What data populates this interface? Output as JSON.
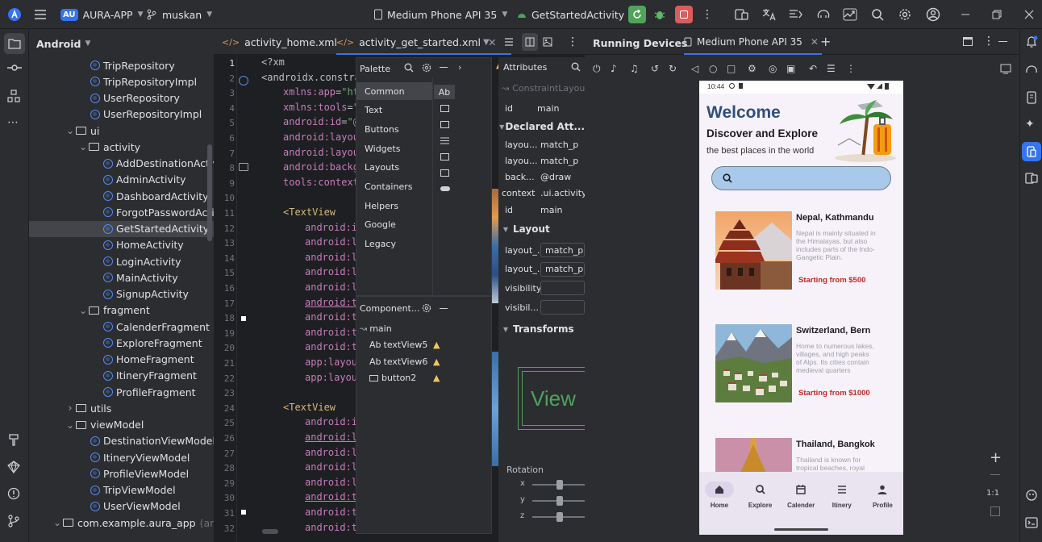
{
  "titlebar": {
    "project_badge": "AU",
    "project_name": "AURA-APP",
    "branch": "muskan",
    "device": "Medium Phone API 35",
    "run_config": "GetStartedActivity"
  },
  "project": {
    "view_mode": "Android",
    "items": [
      {
        "label": "TripRepository",
        "level": 3,
        "kind": "class"
      },
      {
        "label": "TripRepositoryImpl",
        "level": 3,
        "kind": "class"
      },
      {
        "label": "UserRepository",
        "level": 3,
        "kind": "class"
      },
      {
        "label": "UserRepositoryImpl",
        "level": 3,
        "kind": "class"
      },
      {
        "label": "ui",
        "level": 2,
        "kind": "folder",
        "open": true
      },
      {
        "label": "activity",
        "level": 3,
        "kind": "folder",
        "open": true
      },
      {
        "label": "AddDestinationActiv",
        "level": 4,
        "kind": "class"
      },
      {
        "label": "AdminActivity",
        "level": 4,
        "kind": "class"
      },
      {
        "label": "DashboardActivity",
        "level": 4,
        "kind": "class"
      },
      {
        "label": "ForgotPasswordActi",
        "level": 4,
        "kind": "class"
      },
      {
        "label": "GetStartedActivity",
        "level": 4,
        "kind": "class",
        "selected": true
      },
      {
        "label": "HomeActivity",
        "level": 4,
        "kind": "class"
      },
      {
        "label": "LoginActivity",
        "level": 4,
        "kind": "class"
      },
      {
        "label": "MainActivity",
        "level": 4,
        "kind": "class"
      },
      {
        "label": "SignupActivity",
        "level": 4,
        "kind": "class"
      },
      {
        "label": "fragment",
        "level": 3,
        "kind": "folder",
        "open": true
      },
      {
        "label": "CalenderFragment",
        "level": 4,
        "kind": "class"
      },
      {
        "label": "ExploreFragment",
        "level": 4,
        "kind": "class"
      },
      {
        "label": "HomeFragment",
        "level": 4,
        "kind": "class"
      },
      {
        "label": "ItineryFragment",
        "level": 4,
        "kind": "class"
      },
      {
        "label": "ProfileFragment",
        "level": 4,
        "kind": "class"
      },
      {
        "label": "utils",
        "level": 2,
        "kind": "folder",
        "open": false
      },
      {
        "label": "viewModel",
        "level": 2,
        "kind": "folder",
        "open": true
      },
      {
        "label": "DestinationViewModel",
        "level": 3,
        "kind": "class"
      },
      {
        "label": "ItineryViewModel",
        "level": 3,
        "kind": "class"
      },
      {
        "label": "ProfileViewModel",
        "level": 3,
        "kind": "class"
      },
      {
        "label": "TripViewModel",
        "level": 3,
        "kind": "class"
      },
      {
        "label": "UserViewModel",
        "level": 3,
        "kind": "class"
      },
      {
        "label": "com.example.aura_app",
        "level": 1,
        "kind": "folder",
        "open": true,
        "suffix": "(andro"
      }
    ]
  },
  "editor": {
    "tabs": [
      {
        "label": "activity_home.xml",
        "active": false
      },
      {
        "label": "activity_get_started.xml",
        "active": true
      }
    ],
    "line_numbers": [
      "1",
      "2",
      "3",
      "4",
      "5",
      "6",
      "7",
      "8",
      "9",
      "10",
      "11",
      "12",
      "13",
      "14",
      "15",
      "16",
      "17",
      "18",
      "19",
      "20",
      "21",
      "22",
      "23",
      "24",
      "25",
      "26",
      "27",
      "28",
      "29",
      "30",
      "31",
      "32"
    ],
    "lines": [
      {
        "indent": 0,
        "parts": [
          [
            "k",
            "<?xm"
          ]
        ]
      },
      {
        "indent": 0,
        "parts": [
          [
            "k",
            "<androidx.constra"
          ]
        ]
      },
      {
        "indent": 2,
        "parts": [
          [
            "a",
            "xmlns:app"
          ],
          [
            "k",
            "="
          ],
          [
            "s",
            "\"ht"
          ]
        ]
      },
      {
        "indent": 2,
        "parts": [
          [
            "a",
            "xmlns:tools"
          ],
          [
            "k",
            "="
          ],
          [
            "s",
            "\""
          ]
        ]
      },
      {
        "indent": 2,
        "parts": [
          [
            "a",
            "android:id"
          ],
          [
            "k",
            "="
          ],
          [
            "s",
            "\"@"
          ]
        ]
      },
      {
        "indent": 2,
        "parts": [
          [
            "a",
            "android:layou"
          ]
        ]
      },
      {
        "indent": 2,
        "parts": [
          [
            "a",
            "android:layou"
          ]
        ]
      },
      {
        "indent": 2,
        "parts": [
          [
            "a",
            "android:backg"
          ]
        ]
      },
      {
        "indent": 2,
        "parts": [
          [
            "a",
            "tools:context"
          ]
        ]
      },
      {
        "indent": 0,
        "parts": []
      },
      {
        "indent": 2,
        "parts": [
          [
            "t",
            "<TextView"
          ]
        ]
      },
      {
        "indent": 4,
        "parts": [
          [
            "a",
            "android:i"
          ]
        ]
      },
      {
        "indent": 4,
        "parts": [
          [
            "a",
            "android:l"
          ]
        ]
      },
      {
        "indent": 4,
        "parts": [
          [
            "a",
            "android:l"
          ]
        ]
      },
      {
        "indent": 4,
        "parts": [
          [
            "a",
            "android:l"
          ]
        ]
      },
      {
        "indent": 4,
        "parts": [
          [
            "a",
            "android:l"
          ]
        ]
      },
      {
        "indent": 4,
        "parts": [
          [
            "a",
            "android:t"
          ]
        ]
      },
      {
        "indent": 4,
        "parts": [
          [
            "a",
            "android:t"
          ]
        ]
      },
      {
        "indent": 4,
        "parts": [
          [
            "a",
            "android:t"
          ]
        ]
      },
      {
        "indent": 4,
        "parts": [
          [
            "a",
            "android:t"
          ]
        ]
      },
      {
        "indent": 4,
        "parts": [
          [
            "a",
            "app:layou"
          ]
        ]
      },
      {
        "indent": 4,
        "parts": [
          [
            "a",
            "app:layou"
          ]
        ]
      },
      {
        "indent": 0,
        "parts": []
      },
      {
        "indent": 2,
        "parts": [
          [
            "t",
            "<TextView"
          ]
        ]
      },
      {
        "indent": 4,
        "parts": [
          [
            "a",
            "android:i"
          ]
        ]
      },
      {
        "indent": 4,
        "parts": [
          [
            "a",
            "android:l"
          ]
        ]
      },
      {
        "indent": 4,
        "parts": [
          [
            "a",
            "android:l"
          ]
        ]
      },
      {
        "indent": 4,
        "parts": [
          [
            "a",
            "android:l"
          ]
        ]
      },
      {
        "indent": 4,
        "parts": [
          [
            "a",
            "android:l"
          ]
        ]
      },
      {
        "indent": 4,
        "parts": [
          [
            "a",
            "android:t"
          ]
        ]
      },
      {
        "indent": 4,
        "parts": [
          [
            "a",
            "android:t"
          ]
        ]
      },
      {
        "indent": 4,
        "parts": [
          [
            "a",
            "android:t"
          ]
        ]
      }
    ],
    "warning_count": "7",
    "error_count": "1"
  },
  "palette": {
    "title": "Palette",
    "categories": [
      "Common",
      "Text",
      "Buttons",
      "Widgets",
      "Layouts",
      "Containers",
      "Helpers",
      "Google",
      "Legacy"
    ],
    "selected_widget": "Ab"
  },
  "component_tree": {
    "title": "Component...",
    "root": "main",
    "children": [
      {
        "label": "textView5",
        "prefix": "Ab"
      },
      {
        "label": "textView6",
        "prefix": "Ab"
      },
      {
        "label": "button2",
        "prefix": ""
      }
    ]
  },
  "attributes": {
    "title": "Attributes",
    "widget_type": "ConstraintLayou",
    "id_label": "id",
    "id_value": "main",
    "declared_section": "Declared Att...",
    "declared": [
      {
        "name": "layou...",
        "value": "match_p"
      },
      {
        "name": "layou...",
        "value": "match_p"
      },
      {
        "name": "back...",
        "value": "@draw"
      },
      {
        "name": "context",
        "value": ".ui.activity"
      },
      {
        "name": "id",
        "value": "main"
      }
    ],
    "layout_section": "Layout",
    "layout": [
      {
        "name": "layout_...",
        "value": "match_p"
      },
      {
        "name": "layout_...",
        "value": "match_p"
      },
      {
        "name": "visibility",
        "value": ""
      },
      {
        "name": "visibil...",
        "value": ""
      }
    ],
    "transforms_section": "Transforms",
    "preview_text": "View",
    "rotation_label": "Rotation",
    "axes": [
      "x",
      "y",
      "z"
    ]
  },
  "devices": {
    "title": "Running Devices",
    "device_tab": "Medium Phone API 35",
    "zoom_label": "1:1"
  },
  "phone": {
    "time": "10:44",
    "welcome": "Welcome",
    "headline": "Discover and Explore",
    "subline": "the best places in the world",
    "cards": [
      {
        "title": "Nepal, Kathmandu",
        "desc": "Nepal is mainly situated in the Himalayas, but also includes parts of the Indo-Gangetic Plain.",
        "price": "Starting from $500"
      },
      {
        "title": "Switzerland, Bern",
        "desc": "Home to numerous lakes, villages, and high peaks of Alps. Its cities contain medieval quarters",
        "price": "Starting from $1000"
      },
      {
        "title": "Thailand, Bangkok",
        "desc": "Thailand is known for tropical beaches, royal",
        "price": ""
      }
    ],
    "nav": [
      {
        "label": "Home",
        "icon": "home-icon",
        "active": true
      },
      {
        "label": "Explore",
        "icon": "explore-icon",
        "active": false
      },
      {
        "label": "Calender",
        "icon": "calendar-icon",
        "active": false
      },
      {
        "label": "Itinery",
        "icon": "list-icon",
        "active": false
      },
      {
        "label": "Profile",
        "icon": "person-icon",
        "active": false
      }
    ]
  },
  "colors": {
    "accent": "#3574f0",
    "run_green": "#4fa35b",
    "stop_red": "#db5c5c",
    "warning": "#f2c55c",
    "welcome_text": "#2f4e7e",
    "price_red": "#c62828",
    "search_bg": "#a9c9ea"
  }
}
